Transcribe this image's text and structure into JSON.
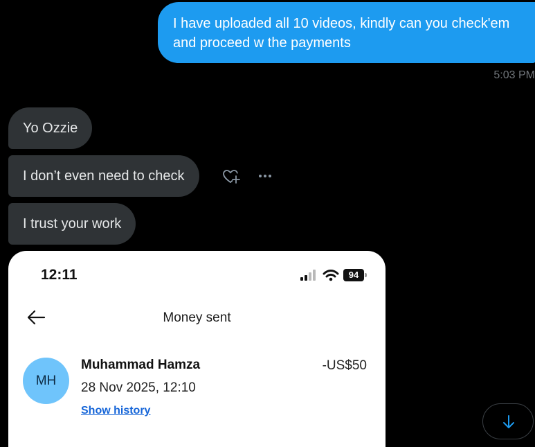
{
  "messages": {
    "outgoing": {
      "text": "I have uploaded all 10 videos, kindly can you check'em and proceed w the payments",
      "time": "5:03 PM"
    },
    "incoming": [
      {
        "text": "Yo Ozzie"
      },
      {
        "text": "I don’t even need to check"
      },
      {
        "text": "I trust your work"
      }
    ],
    "actions": {
      "react_icon": "heart-plus-icon",
      "more_icon": "more-icon"
    }
  },
  "attachment": {
    "status_bar": {
      "time": "12:11",
      "battery": "94"
    },
    "title": "Money sent",
    "recipient": {
      "initials": "MH",
      "name": "Muhammad Hamza"
    },
    "date": "28 Nov 2025, 12:10",
    "amount": "-US$50",
    "link": "Show history"
  },
  "colors": {
    "background": "#000000",
    "outgoing_bubble": "#1d9bf0",
    "incoming_bubble": "#2f3336",
    "avatar": "#6fc4fb",
    "link": "#1565d8"
  },
  "scroll_button_icon": "arrow-down-icon"
}
